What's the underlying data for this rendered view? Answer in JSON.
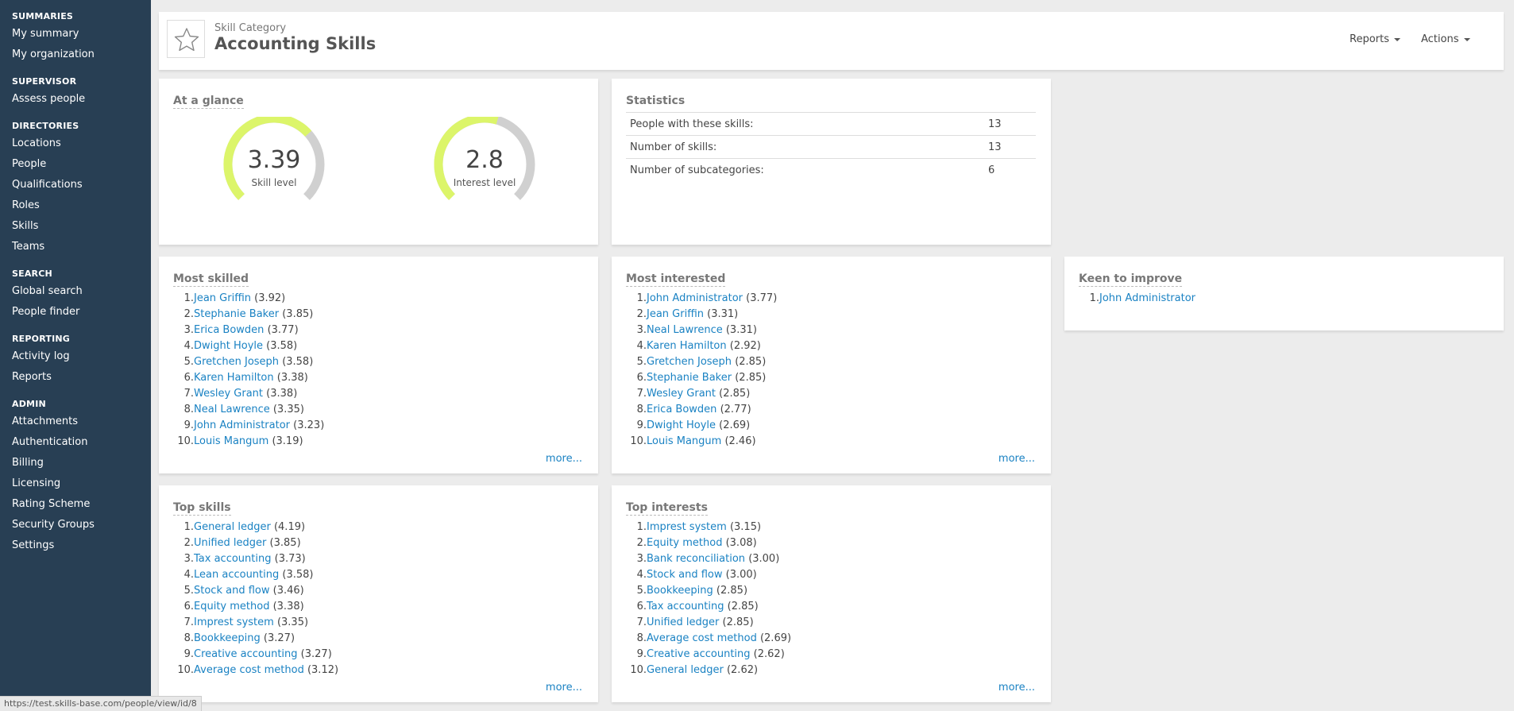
{
  "sidebar": {
    "sections": [
      {
        "heading": "SUMMARIES",
        "items": [
          "My summary",
          "My organization"
        ]
      },
      {
        "heading": "SUPERVISOR",
        "items": [
          "Assess people"
        ]
      },
      {
        "heading": "DIRECTORIES",
        "items": [
          "Locations",
          "People",
          "Qualifications",
          "Roles",
          "Skills",
          "Teams"
        ]
      },
      {
        "heading": "SEARCH",
        "items": [
          "Global search",
          "People finder"
        ]
      },
      {
        "heading": "REPORTING",
        "items": [
          "Activity log",
          "Reports"
        ]
      },
      {
        "heading": "ADMIN",
        "items": [
          "Attachments",
          "Authentication",
          "Billing",
          "Licensing",
          "Rating Scheme",
          "Security Groups",
          "Settings"
        ]
      }
    ]
  },
  "header": {
    "kicker": "Skill Category",
    "title": "Accounting Skills",
    "icon": "star-icon",
    "reports_label": "Reports",
    "actions_label": "Actions"
  },
  "glance": {
    "title": "At a glance",
    "skill": {
      "value": "3.39",
      "label": "Skill level",
      "fraction": 0.678
    },
    "interest": {
      "value": "2.8",
      "label": "Interest level",
      "fraction": 0.56
    },
    "fill_color": "#dcf56a",
    "track_color": "#d0d0d0"
  },
  "statistics": {
    "title": "Statistics",
    "rows": [
      {
        "label": "People with these skills:",
        "value": "13"
      },
      {
        "label": "Number of skills:",
        "value": "13"
      },
      {
        "label": "Number of subcategories:",
        "value": "6"
      }
    ]
  },
  "most_skilled": {
    "title": "Most skilled",
    "more": "more...",
    "items": [
      {
        "name": "Jean Griffin",
        "score": "(3.92)"
      },
      {
        "name": "Stephanie Baker",
        "score": "(3.85)"
      },
      {
        "name": "Erica Bowden",
        "score": "(3.77)"
      },
      {
        "name": "Dwight Hoyle",
        "score": "(3.58)"
      },
      {
        "name": "Gretchen Joseph",
        "score": "(3.58)"
      },
      {
        "name": "Karen Hamilton",
        "score": "(3.38)"
      },
      {
        "name": "Wesley Grant",
        "score": "(3.38)"
      },
      {
        "name": "Neal Lawrence",
        "score": "(3.35)"
      },
      {
        "name": "John Administrator",
        "score": "(3.23)"
      },
      {
        "name": "Louis Mangum",
        "score": "(3.19)"
      }
    ]
  },
  "most_interested": {
    "title": "Most interested",
    "more": "more...",
    "items": [
      {
        "name": "John Administrator",
        "score": "(3.77)"
      },
      {
        "name": "Jean Griffin",
        "score": "(3.31)"
      },
      {
        "name": "Neal Lawrence",
        "score": "(3.31)"
      },
      {
        "name": "Karen Hamilton",
        "score": "(2.92)"
      },
      {
        "name": "Gretchen Joseph",
        "score": "(2.85)"
      },
      {
        "name": "Stephanie Baker",
        "score": "(2.85)"
      },
      {
        "name": "Wesley Grant",
        "score": "(2.85)"
      },
      {
        "name": "Erica Bowden",
        "score": "(2.77)"
      },
      {
        "name": "Dwight Hoyle",
        "score": "(2.69)"
      },
      {
        "name": "Louis Mangum",
        "score": "(2.46)"
      }
    ]
  },
  "keen": {
    "title": "Keen to improve",
    "items": [
      {
        "name": "John Administrator",
        "score": ""
      }
    ]
  },
  "top_skills": {
    "title": "Top skills",
    "more": "more...",
    "items": [
      {
        "name": "General ledger",
        "score": "(4.19)"
      },
      {
        "name": "Unified ledger",
        "score": "(3.85)"
      },
      {
        "name": "Tax accounting",
        "score": "(3.73)"
      },
      {
        "name": "Lean accounting",
        "score": "(3.58)"
      },
      {
        "name": "Stock and flow",
        "score": "(3.46)"
      },
      {
        "name": "Equity method",
        "score": "(3.38)"
      },
      {
        "name": "Imprest system",
        "score": "(3.35)"
      },
      {
        "name": "Bookkeeping",
        "score": "(3.27)"
      },
      {
        "name": "Creative accounting",
        "score": "(3.27)"
      },
      {
        "name": "Average cost method",
        "score": "(3.12)"
      }
    ]
  },
  "top_interests": {
    "title": "Top interests",
    "more": "more...",
    "items": [
      {
        "name": "Imprest system",
        "score": "(3.15)"
      },
      {
        "name": "Equity method",
        "score": "(3.08)"
      },
      {
        "name": "Bank reconciliation",
        "score": "(3.00)"
      },
      {
        "name": "Stock and flow",
        "score": "(3.00)"
      },
      {
        "name": "Bookkeeping",
        "score": "(2.85)"
      },
      {
        "name": "Tax accounting",
        "score": "(2.85)"
      },
      {
        "name": "Unified ledger",
        "score": "(2.85)"
      },
      {
        "name": "Average cost method",
        "score": "(2.69)"
      },
      {
        "name": "Creative accounting",
        "score": "(2.62)"
      },
      {
        "name": "General ledger",
        "score": "(2.62)"
      }
    ]
  },
  "status_bar": {
    "url": "https://test.skills-base.com/people/view/id/8"
  }
}
